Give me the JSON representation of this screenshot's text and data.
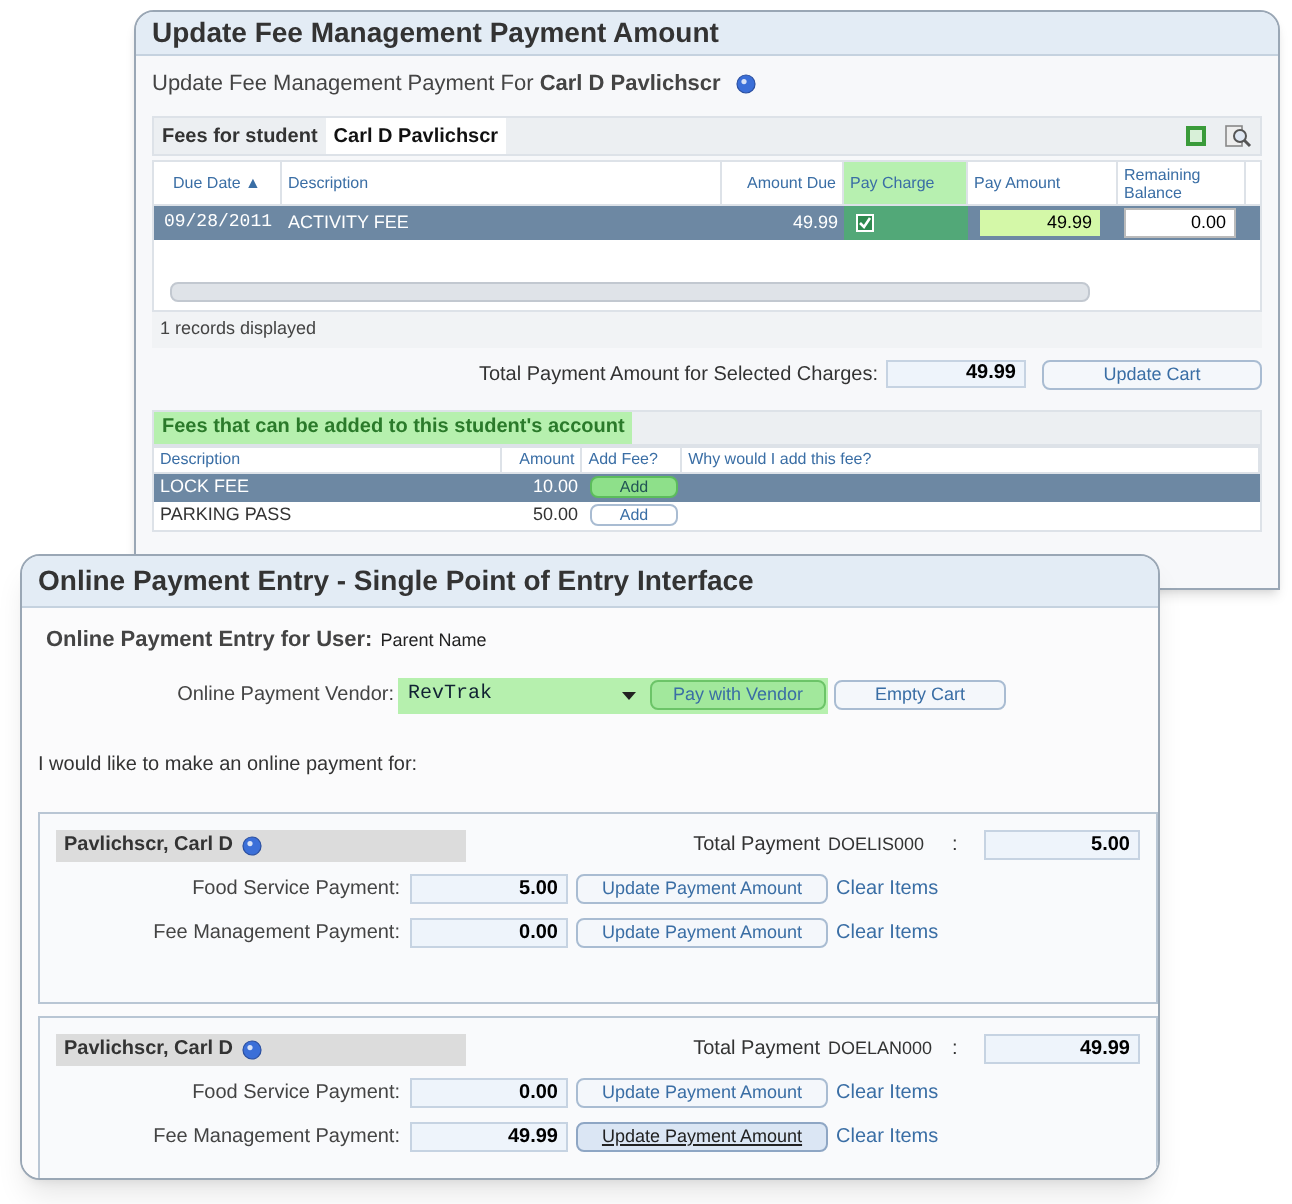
{
  "fee_window": {
    "title": "Update Fee Management Payment Amount",
    "subtitle": "Update Fee Management Payment For **Carl D Pavlichscr**",
    "student_tab": {
      "label": "Fees for student",
      "name": "Carl D Pavlichscr"
    },
    "charges": {
      "columns": [
        "Due Date ▲",
        "Description",
        "Amount Due",
        "Pay Charge",
        "Pay Amount",
        "Remaining Balance"
      ],
      "rows": [
        {
          "due_date": "09/28/2011",
          "description": "ACTIVITY FEE",
          "amount_due": "49.99",
          "pay_charge": true,
          "pay_amount": "49.99",
          "remaining": "0.00",
          "selected": true
        }
      ],
      "footer": "1 records displayed"
    },
    "total_label": "Total Payment Amount for Selected Charges:",
    "total_value": "49.99",
    "update_button": "Update Cart",
    "addable": {
      "title": "Fees that can be added to this student's account",
      "columns": [
        "Description",
        "Amount",
        "Add Fee?",
        "Why would I add this fee?"
      ],
      "rows": [
        {
          "description": "LOCK FEE",
          "amount": "10.00",
          "button": "Add",
          "selected": true
        },
        {
          "description": "PARKING PASS",
          "amount": "50.00",
          "button": "Add",
          "selected": false
        }
      ]
    }
  },
  "payment_window": {
    "title": "Online Payment Entry - Single Point of Entry Interface",
    "user_label": "Online Payment Entry for User:",
    "user_name": "Parent Name",
    "vendor_label": "Online Payment Vendor:",
    "vendor_value": "RevTrak",
    "pay_button": "Pay with Vendor",
    "empty_button": "Empty Cart",
    "intro": "I would like to make an online payment for:",
    "students": [
      {
        "name": "Pavlichscr, Carl D",
        "total_label": "Total Payment",
        "code": "DOELIS000",
        "colon": ":",
        "total": "5.00",
        "payments": [
          {
            "label": "Food Service Payment:",
            "value": "5.00",
            "button": "Update Payment Amount",
            "focused": false,
            "link": "Clear Items"
          },
          {
            "label": "Fee Management Payment:",
            "value": "0.00",
            "button": "Update Payment Amount",
            "focused": false,
            "link": "Clear Items"
          }
        ]
      },
      {
        "name": "Pavlichscr, Carl D",
        "total_label": "Total Payment",
        "code": "DOELAN000",
        "colon": ":",
        "total": "49.99",
        "payments": [
          {
            "label": "Food Service Payment:",
            "value": "0.00",
            "button": "Update Payment Amount",
            "focused": false,
            "link": "Clear Items"
          },
          {
            "label": "Fee Management Payment:",
            "value": "49.99",
            "button": "Update Payment Amount",
            "focused": true,
            "link": "Clear Items"
          }
        ]
      }
    ]
  }
}
